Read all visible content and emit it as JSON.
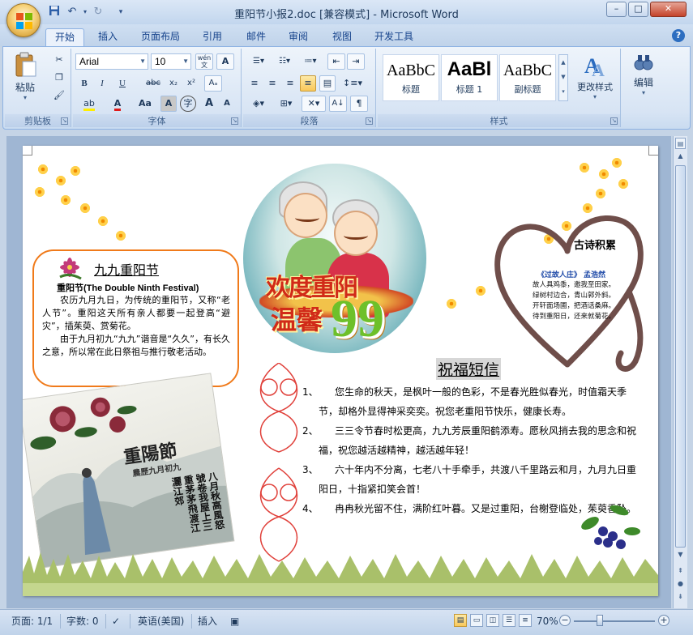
{
  "window": {
    "title": "重阳节小报2.doc [兼容模式] - Microsoft Word",
    "minimize": "–",
    "maximize": "□",
    "close": "✕"
  },
  "quick_access": {
    "save_icon": "save-icon",
    "undo_icon": "undo-icon",
    "redo_icon": "redo-icon"
  },
  "tabs": [
    "开始",
    "插入",
    "页面布局",
    "引用",
    "邮件",
    "审阅",
    "视图",
    "开发工具"
  ],
  "ribbon": {
    "clipboard": {
      "paste_label": "粘贴",
      "group_label": "剪贴板"
    },
    "font": {
      "font_name": "Arial",
      "font_size": "10",
      "group_label": "字体",
      "bold": "B",
      "italic": "I",
      "underline": "U",
      "strike": "abc",
      "sub": "x₂",
      "sup": "x²",
      "grow": "A",
      "shrink": "A",
      "case": "Aa",
      "char_shading": "A",
      "enclose": "字",
      "wen": "wén",
      "clear": "A",
      "font_color": "A",
      "highlight": "ab"
    },
    "paragraph": {
      "group_label": "段落"
    },
    "styles": {
      "group_label": "样式",
      "items": [
        {
          "sample": "AaBbC",
          "name": "标题"
        },
        {
          "sample": "AaBl",
          "name": "标题 1"
        },
        {
          "sample": "AaBbC",
          "name": "副标题"
        }
      ],
      "change_styles": "更改样式"
    },
    "editing": {
      "label": "编辑"
    }
  },
  "document": {
    "info_box": {
      "title": "九九重阳节",
      "subtitle": "重阳节(The Double Ninth Festival)",
      "para1": "农历九月九日，为传统的重阳节，又称“老人节”。重阳这天所有亲人都要一起登高“避灾”，插茱萸、赏菊花。",
      "para2": "由于九月初九“九九”谐音是“久久”，有长久之意，所以常在此日祭祖与推行敬老活动。"
    },
    "festival_banner": {
      "line1": "欢度重阳",
      "line2": "温馨",
      "number": "99"
    },
    "painting": {
      "title": "重陽節",
      "subtitle": "農歷九月初九",
      "poem": "八月秋高風怒號卷我屋上三重茅茅飛渡江灑江郊"
    },
    "heart": {
      "title": "古诗积累",
      "poem_title": "《过故人庄》 孟浩然",
      "poem_lines": [
        "故人具鸡黍，邀我至田家。",
        "绿树村边合，青山郭外斜。",
        "开轩面场圃，把酒话桑麻。",
        "待到重阳日，还来就菊花。"
      ]
    },
    "blessings": {
      "title": "祝福短信",
      "items": [
        {
          "num": "1、",
          "text": "您生命的秋天，是枫叶一般的色彩，不是春光胜似春光，时值霜天季节，却格外显得神采奕奕。祝您老重阳节快乐，健康长寿。"
        },
        {
          "num": "2、",
          "text": "三三令节春时松更高，九九芳辰重阳鹤添寿。愿秋风捎去我的思念和祝福，祝您越活越精神，越活越年轻！"
        },
        {
          "num": "3、",
          "text": "六十年内不分离，七老八十手牵手，共渡八千里路云和月，九月九日重阳日，十指紧扣笑会首！"
        },
        {
          "num": "4、",
          "text": "冉冉秋光留不住，满阶红叶暮。又是过重阳，台榭登临处，茱萸香坠。"
        }
      ]
    }
  },
  "status_bar": {
    "page": "页面: 1/1",
    "words": "字数: 0",
    "language": "英语(美国)",
    "mode": "插入",
    "zoom": "70%",
    "zoom_out": "−",
    "zoom_in": "+"
  },
  "colors": {
    "accent": "#2b579a",
    "ribbon_bg": "#dbe7f6",
    "box_border": "#f07a1a",
    "banner_red": "#d12a18",
    "banner_green": "#6ec02a"
  }
}
